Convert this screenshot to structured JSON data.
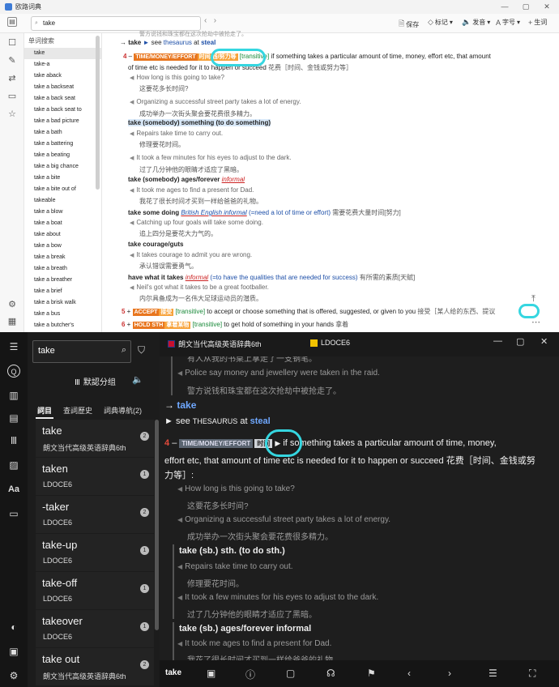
{
  "top": {
    "window_title": "欧路词典",
    "search_value": "take",
    "toolbar": {
      "save": "保存",
      "mark": "标记",
      "voice": "发音",
      "font": "字号",
      "vocab": "生词"
    },
    "list_header": "单词搜索",
    "word_list": [
      "take",
      "take-a",
      "take aback",
      "take a backseat",
      "take a back seat",
      "take a back seat to",
      "take a bad picture",
      "take a bath",
      "take a battering",
      "take a beating",
      "take a big chance",
      "take a bite",
      "take a bite out of",
      "takeable",
      "take a blow",
      "take a boat",
      "take about",
      "take a bow",
      "take a break",
      "take a breath",
      "take a breather",
      "take a brief",
      "take a brisk walk",
      "take a bus",
      "take a butcher's"
    ],
    "content": {
      "top_cut": "警方说钱和珠宝都在这次抢劫中被抢走了。",
      "ref_take": "take",
      "ref_see": "see",
      "ref_thesaurus": "thesaurus",
      "ref_at": "at",
      "ref_steal": "steal",
      "sense4_num": "4",
      "sense4_tag": "TIME/MONEY/EFFORT",
      "sense4_tagcn": "时间/钱/努力等",
      "sense4_gram": "[transitive]",
      "sense4_def1": "if something takes a particular amount of time, money, effort etc, that amount",
      "sense4_def2": "of time etc is needed for it to happen or succeed",
      "sense4_cn": "花费［时间、金钱或努力等］",
      "ex1": "How long is this going to take?",
      "ex1cn": "这要花多长时间?",
      "ex2": "Organizing a successful street party takes a lot of energy.",
      "ex2cn": "成功举办一次街头聚会要花费很多精力。",
      "p1": "take (somebody) something (to do something)",
      "ex3": "Repairs take time to carry out.",
      "ex3cn": "修理要花时间。",
      "ex4": "It took a few minutes for his eyes to adjust to the dark.",
      "ex4cn": "过了几分钟他的眼睛才适应了黑暗。",
      "p2": "take (somebody) ages/forever",
      "p2_informal": "informal",
      "ex5": "It took me ages to find a present for Dad.",
      "ex5cn": "我花了很长时间才买到一样给爸爸的礼物。",
      "p3": "take some doing",
      "p3_reg": "British English informal",
      "p3_gloss": "(=need a lot of time or effort)",
      "p3_cn": "需要花费大量时间[努力]",
      "ex6": "Catching up four goals will take some doing.",
      "ex6cn": "追上四分是要花大力气的。",
      "p4": "take courage/guts",
      "ex7": "It takes courage to admit you are wrong.",
      "ex7cn": "承认错误需要勇气。",
      "p5": "have what it takes",
      "p5_informal": "informal",
      "p5_gloss": "(=to have the qualities that are needed for success)",
      "p5_cn": "有所需的素质[天赋]",
      "ex8": "Neil's got what it takes to be a great footballer.",
      "ex8cn": "内尔具备成为一名伟大足球运动员的潜质。",
      "s5_num": "5",
      "s5_tag": "ACCEPT",
      "s5_tagcn": "接受",
      "s5_gram": "[transitive]",
      "s5_def": "to accept or choose something that is offered, suggested, or given to you",
      "s5_cn": "接受［某人给的东西、提议",
      "s6_num": "6",
      "s6_tag": "HOLD STH",
      "s6_tagcn": "拿着某物",
      "s6_gram": "[transitive]",
      "s6_def": "to get hold of something in your hands",
      "s6_cn": "拿着"
    }
  },
  "bottom": {
    "search_value": "take",
    "group_label": "默認分组",
    "tabs": [
      "詞目",
      "查詞歷史",
      "詞典導航(2)"
    ],
    "entries": [
      {
        "word": "take",
        "dict": "朗文当代高级英语辞典6th",
        "count": "2"
      },
      {
        "word": "taken",
        "dict": "LDOCE6",
        "count": "1"
      },
      {
        "word": "-taker",
        "dict": "LDOCE6",
        "count": "2"
      },
      {
        "word": "take-up",
        "dict": "LDOCE6",
        "count": "1"
      },
      {
        "word": "take-off",
        "dict": "LDOCE6",
        "count": "1"
      },
      {
        "word": "takeover",
        "dict": "LDOCE6",
        "count": "1"
      },
      {
        "word": "take  out",
        "dict": "朗文当代高级英语辞典6th",
        "count": "2"
      }
    ],
    "dict_tabs": [
      "朗文当代高级英语辞典6th",
      "LDOCE6"
    ],
    "content": {
      "c0": "有人从我的书桌上拿走了一支钢笔。",
      "c1": "Police say money and jewellery were taken in the raid.",
      "c1cn": "警方说钱和珠宝都在这次抢劫中被抢走了。",
      "arrow_take": "take",
      "see": "see",
      "thesaurus": "THESAURUS",
      "at": "at",
      "steal": "steal",
      "s4": "4",
      "tag": "TIME/MONEY/EFFORT",
      "tagcn": "时间",
      "def1": "if something takes a particular amount of time, money,",
      "def2": "effort etc, that amount of time etc is needed for it to happen or succeed  花费［时间、金钱或努",
      "def3": "力等］:",
      "e1": "How long is this going to take?",
      "e1cn": "这要花多长时间?",
      "e2": "Organizing a successful street party takes a lot of energy.",
      "e2cn": "成功举办一次街头聚会要花费很多精力。",
      "p1": "take (sb.) sth. (to do sth.)",
      "e3": "Repairs take time to carry out.",
      "e3cn": "修理要花时间。",
      "e4": "It took a few minutes for his eyes to adjust to the dark.",
      "e4cn": "过了几分钟他的眼睛才适应了黑暗。",
      "p2": "take (sb.) ages/forever informal",
      "e5": "It took me ages to find a present for Dad.",
      "e5cn": "我花了很长时间才买到一样给爸爸的礼物。"
    },
    "bar_word": "take"
  }
}
